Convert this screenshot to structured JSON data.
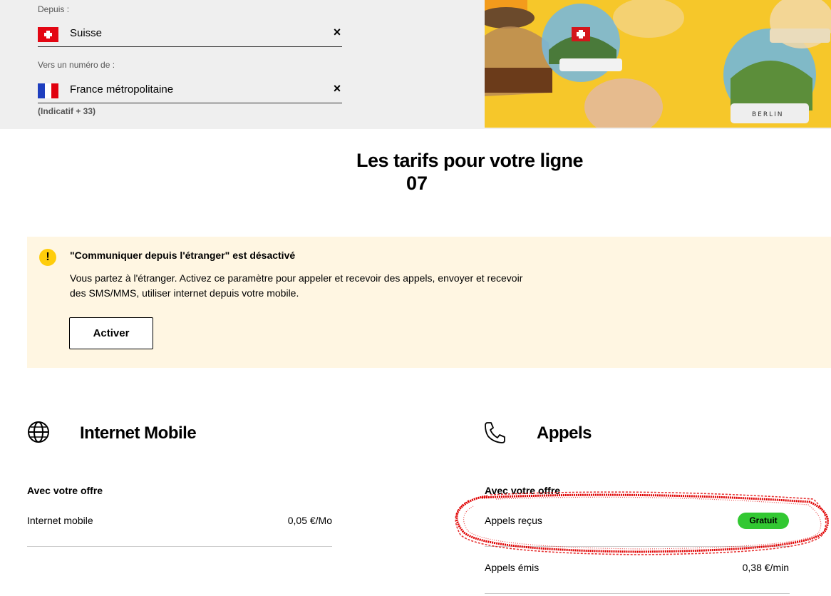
{
  "origin": {
    "label": "Depuis :",
    "value": "Suisse"
  },
  "destination": {
    "label": "Vers un numéro de :",
    "value": "France métropolitaine",
    "hint": "(Indicatif + 33)"
  },
  "hero": {
    "sign_text": "BERLIN"
  },
  "page": {
    "title_line1": "Les tarifs pour votre ligne",
    "title_line2": "07"
  },
  "alert": {
    "icon": "!",
    "title": "\"Communiquer depuis l'étranger\" est désactivé",
    "body": "Vous partez à l'étranger. Activez ce paramètre pour appeler et recevoir des appels, envoyer et recevoir des SMS/MMS, utiliser internet depuis votre mobile.",
    "button_label": "Activer"
  },
  "internet": {
    "icon": "globe-icon",
    "title": "Internet Mobile",
    "subheading": "Avec votre offre",
    "rows": [
      {
        "label": "Internet mobile",
        "value": "0,05 €/Mo"
      }
    ]
  },
  "calls": {
    "icon": "phone-icon",
    "title": "Appels",
    "subheading": "Avec votre offre",
    "rows": [
      {
        "label": "Appels reçus",
        "value": "Gratuit"
      },
      {
        "label": "Appels émis",
        "value": "0,38 €/min"
      }
    ]
  },
  "colors": {
    "alert_bg": "#fff6e2",
    "alert_icon": "#ffcd0b",
    "badge_green": "#32c832",
    "annotation_red": "#e00000"
  }
}
